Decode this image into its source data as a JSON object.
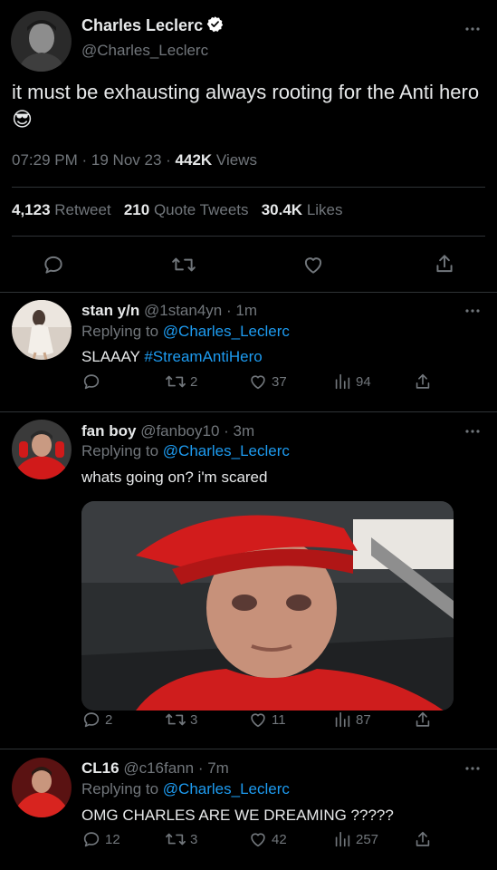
{
  "main_tweet": {
    "author_name": "Charles Leclerc",
    "author_handle": "@Charles_Leclerc",
    "text": "it must be exhausting always rooting for the Anti hero 😎",
    "time": "07:29 PM",
    "date": "19 Nov 23",
    "views_count": "442K",
    "views_label": "Views",
    "retweets_count": "4,123",
    "retweets_label": "Retweet",
    "quotes_count": "210",
    "quotes_label": "Quote Tweets",
    "likes_count": "30.4K",
    "likes_label": "Likes"
  },
  "replies": [
    {
      "name": "stan y/n",
      "handle": "@1stan4yn",
      "age": "1m",
      "replying_prefix": "Replying to",
      "replying_to": "@Charles_Leclerc",
      "text_plain": "SLAAAY",
      "text_hashtag": "#StreamAntiHero",
      "replies": "",
      "retweets": "2",
      "likes": "37",
      "views": "94"
    },
    {
      "name": "fan boy",
      "handle": "@fanboy10",
      "age": "3m",
      "replying_prefix": "Replying to",
      "replying_to": "@Charles_Leclerc",
      "text": "whats going on? i'm scared",
      "replies": "2",
      "retweets": "3",
      "likes": "11",
      "views": "87"
    },
    {
      "name": "CL16",
      "handle": "@c16fann",
      "age": "7m",
      "replying_prefix": "Replying to",
      "replying_to": "@Charles_Leclerc",
      "text": "OMG CHARLES ARE WE DREAMING ?????",
      "replies": "12",
      "retweets": "3",
      "likes": "42",
      "views": "257"
    }
  ],
  "sep": "·",
  "colors": {
    "background": "#000000",
    "text": "#e7e9ea",
    "muted": "#71767b",
    "link": "#1d9bf0",
    "divider": "#2f3336"
  }
}
